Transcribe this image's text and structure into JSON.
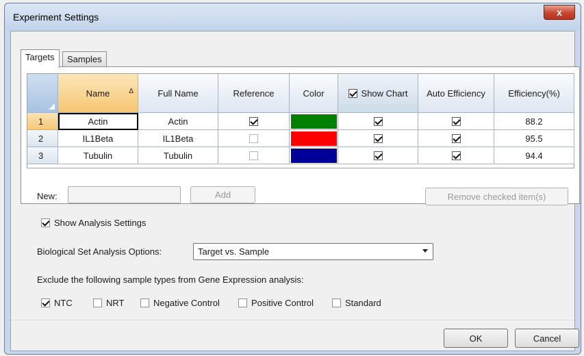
{
  "window": {
    "title": "Experiment Settings",
    "close_glyph": "x"
  },
  "tabs": [
    {
      "label": "Targets",
      "active": true
    },
    {
      "label": "Samples",
      "active": false
    }
  ],
  "grid": {
    "columns": [
      "Name",
      "Full Name",
      "Reference",
      "Color",
      "Show Chart",
      "Auto Efficiency",
      "Efficiency(%)"
    ],
    "sort_glyph": "Δ",
    "show_chart_header_checked": true,
    "rows": [
      {
        "num": "1",
        "name": "Actin",
        "full_name": "Actin",
        "reference": true,
        "color": "#008000",
        "show_chart": true,
        "auto_efficiency": true,
        "efficiency": "88.2"
      },
      {
        "num": "2",
        "name": "IL1Beta",
        "full_name": "IL1Beta",
        "reference": false,
        "color": "#ff0000",
        "show_chart": true,
        "auto_efficiency": true,
        "efficiency": "95.5"
      },
      {
        "num": "3",
        "name": "Tubulin",
        "full_name": "Tubulin",
        "reference": false,
        "color": "#000099",
        "show_chart": true,
        "auto_efficiency": true,
        "efficiency": "94.4"
      }
    ]
  },
  "new_row": {
    "label": "New:",
    "value": "",
    "add_label": "Add",
    "remove_label": "Remove checked item(s)"
  },
  "analysis": {
    "show_settings_label": "Show Analysis Settings",
    "show_settings_checked": true,
    "bio_set_label": "Biological Set Analysis Options:",
    "bio_set_value": "Target vs. Sample",
    "exclude_label": "Exclude the following sample types from Gene Expression analysis:",
    "sample_types": [
      {
        "label": "NTC",
        "checked": true
      },
      {
        "label": "NRT",
        "checked": false
      },
      {
        "label": "Negative Control",
        "checked": false
      },
      {
        "label": "Positive Control",
        "checked": false
      },
      {
        "label": "Standard",
        "checked": false
      }
    ]
  },
  "footer": {
    "ok_label": "OK",
    "cancel_label": "Cancel"
  }
}
